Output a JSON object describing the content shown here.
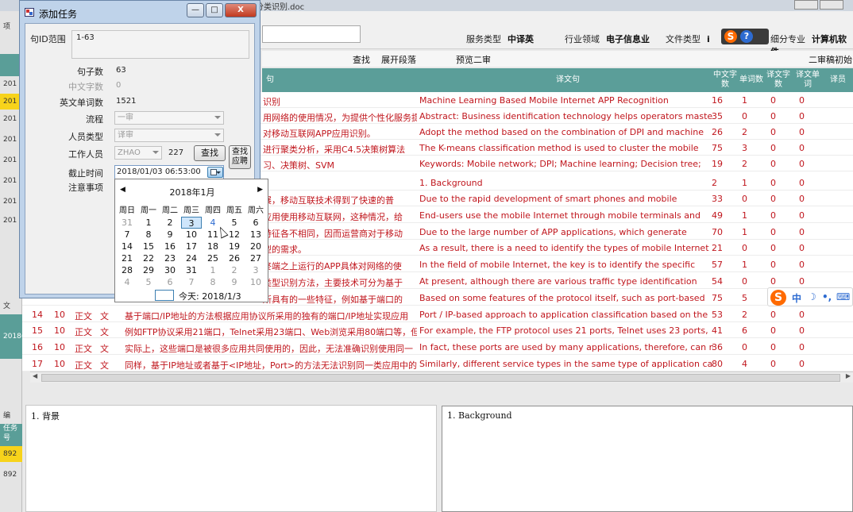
{
  "window": {
    "filename_fragment": "分类识别.doc"
  },
  "header_info": {
    "service_type_label": "服务类型",
    "service_type_value": "中译英",
    "industry_label": "行业领域",
    "industry_value": "电子信息业",
    "file_type_label": "文件类型",
    "file_type_value": "i",
    "subspecialty_label": "细分专业",
    "subspecialty_value": "计算机软件"
  },
  "actions": {
    "find": "查找",
    "expand_paragraph": "展开段落",
    "preview_second_review": "预览二审",
    "second_review_draft": "二审稿初始"
  },
  "grid": {
    "headers": {
      "source": "句",
      "target": "译文句",
      "cn_chars": "中文字数",
      "word_count": "单词数",
      "translated_chars": "译文字数",
      "translated_words": "译文单词",
      "translator": "译员"
    },
    "rows": [
      {
        "no": "",
        "para": "",
        "kind": "",
        "tag": "",
        "source": "识别",
        "target": "Machine Learning Based Mobile Internet APP Recognition",
        "cn": "16",
        "w": "1",
        "tc": "0",
        "tw": "0"
      },
      {
        "no": "",
        "para": "",
        "kind": "",
        "tag": "",
        "source": "用网络的使用情况，为提供个性化服务提",
        "target": "Abstract: Business identification technology helps operators master",
        "cn": "35",
        "w": "0",
        "tc": "0",
        "tw": "0"
      },
      {
        "no": "",
        "para": "",
        "kind": "",
        "tag": "",
        "source": "对移动互联网APP应用识别。",
        "target": "Adopt the method based on the combination of DPI and machine",
        "cn": "26",
        "w": "2",
        "tc": "0",
        "tw": "0"
      },
      {
        "no": "",
        "para": "",
        "kind": "",
        "tag": "",
        "source": "进行聚类分析，采用C4.5决策树算法",
        "target": "The K-means classification method is used to cluster the mobile",
        "cn": "75",
        "w": "3",
        "tc": "0",
        "tw": "0"
      },
      {
        "no": "",
        "para": "",
        "kind": "",
        "tag": "",
        "source": "习、决策树、SVM",
        "target": "Keywords: Mobile network; DPI; Machine learning; Decision tree;",
        "cn": "19",
        "w": "2",
        "tc": "0",
        "tw": "0"
      },
      {
        "no": "",
        "para": "",
        "kind": "",
        "tag": "",
        "source": "",
        "target": "1. Background",
        "cn": "2",
        "w": "1",
        "tc": "0",
        "tw": "0"
      },
      {
        "no": "",
        "para": "",
        "kind": "",
        "tag": "",
        "source": "展，移动互联技术得到了快速的普",
        "target": "Due to the rapid development of smart phones and mobile",
        "cn": "33",
        "w": "0",
        "tc": "0",
        "tw": "0"
      },
      {
        "no": "",
        "para": "",
        "kind": "",
        "tag": "",
        "source": "应用使用移动互联网，这种情况，给",
        "target": "End-users use the mobile Internet through mobile terminals and",
        "cn": "49",
        "w": "1",
        "tc": "0",
        "tw": "0"
      },
      {
        "no": "",
        "para": "",
        "kind": "",
        "tag": "",
        "source": "特征各不相同，因而运营商对于移动",
        "target": "Due to the large number of APP applications, which generate",
        "cn": "70",
        "w": "1",
        "tc": "0",
        "tw": "0"
      },
      {
        "no": "",
        "para": "",
        "kind": "",
        "tag": "",
        "source": "型的需求。",
        "target": "As a result, there is a need to identify the types of mobile Internet",
        "cn": "21",
        "w": "0",
        "tc": "0",
        "tw": "0"
      },
      {
        "no": "",
        "para": "",
        "kind": "",
        "tag": "",
        "source": "终端之上运行的APP具体对网络的使",
        "target": "In the field of mobile Internet, the key is to identify the specific",
        "cn": "57",
        "w": "1",
        "tc": "0",
        "tw": "0"
      },
      {
        "no": "",
        "para": "",
        "kind": "",
        "tag": "",
        "source": "类型识别方法，主要技术可分为基于",
        "target": "At present, although there are various traffic type identification",
        "cn": "54",
        "w": "0",
        "tc": "0",
        "tw": "0"
      },
      {
        "no": "",
        "para": "",
        "kind": "",
        "tag": "",
        "source": "所具有的一些特征，例如基于端口的",
        "target": "Based on some features of the protocol itself, such as port-based",
        "cn": "75",
        "w": "5",
        "tc": "0",
        "tw": "0"
      },
      {
        "no": "14",
        "para": "10",
        "kind": "正文",
        "tag": "文",
        "source": "基于端口/IP地址的方法根据应用协议所采用的独有的端口/IP地址实现应用",
        "target": "Port / IP-based approach to application classification based on the",
        "cn": "53",
        "w": "2",
        "tc": "0",
        "tw": "0"
      },
      {
        "no": "15",
        "para": "10",
        "kind": "正文",
        "tag": "文",
        "source": "例如FTP协议采用21端口，Telnet采用23端口、Web浏览采用80端口等，但",
        "target": "For example, the FTP protocol uses 21 ports, Telnet uses 23 ports,",
        "cn": "41",
        "w": "6",
        "tc": "0",
        "tw": "0"
      },
      {
        "no": "16",
        "para": "10",
        "kind": "正文",
        "tag": "文",
        "source": "实际上，这些端口是被很多应用共同使用的，因此，无法准确识别使用同一",
        "target": "In fact, these ports are used by many applications, therefore, can not",
        "cn": "36",
        "w": "0",
        "tc": "0",
        "tw": "0"
      },
      {
        "no": "17",
        "para": "10",
        "kind": "正文",
        "tag": "文",
        "source": "同样，基于IP地址或者基于<IP地址，Port>的方法无法识别同一类应用中的",
        "target": "Similarly, different service types in the same type of application can",
        "cn": "80",
        "w": "4",
        "tc": "0",
        "tw": "0"
      }
    ]
  },
  "bottom": {
    "source_text": "1. 背景",
    "target_text": "1. Background"
  },
  "left_strip": {
    "items": [
      "项",
      "201",
      "201",
      "201",
      "201",
      "201",
      "201",
      "201",
      "201",
      "文",
      "2018(",
      "编",
      "任务号",
      "892",
      "892"
    ]
  },
  "ime": {
    "logo": "S",
    "help": "?",
    "lang": "中"
  },
  "dialog": {
    "title": "添加任务",
    "min": "—",
    "max": "□",
    "close": "X",
    "range_label": "句ID范围",
    "range_value": "1-63",
    "sentence_count_label": "句子数",
    "sentence_count_value": "63",
    "cn_chars_label": "中文字数",
    "cn_chars_value": "0",
    "en_words_label": "英文单词数",
    "en_words_value": "1521",
    "process_label": "流程",
    "process_value": "一审",
    "staff_type_label": "人员类型",
    "staff_type_value": "译审",
    "worker_label": "工作人员",
    "worker_value": "ZHAO",
    "worker_count": "227",
    "find_button": "查找",
    "find_apply_button_line1": "查找",
    "find_apply_button_line2": "应聘",
    "deadline_label": "截止时间",
    "deadline_value": "2018/01/03 06:53:00",
    "notes_label": "注意事项"
  },
  "calendar": {
    "month_title": "2018年1月",
    "prev": "◀",
    "next": "▶",
    "weekdays": [
      "周日",
      "周一",
      "周二",
      "周三",
      "周四",
      "周五",
      "周六"
    ],
    "weeks": [
      [
        "31",
        "1",
        "2",
        "3",
        "4",
        "5",
        "6"
      ],
      [
        "7",
        "8",
        "9",
        "10",
        "11",
        "12",
        "13"
      ],
      [
        "14",
        "15",
        "16",
        "17",
        "18",
        "19",
        "20"
      ],
      [
        "21",
        "22",
        "23",
        "24",
        "25",
        "26",
        "27"
      ],
      [
        "28",
        "29",
        "30",
        "31",
        "1",
        "2",
        "3"
      ],
      [
        "4",
        "5",
        "6",
        "7",
        "8",
        "9",
        "10"
      ]
    ],
    "selected_day": "3",
    "today_label": "今天: 2018/1/3"
  }
}
